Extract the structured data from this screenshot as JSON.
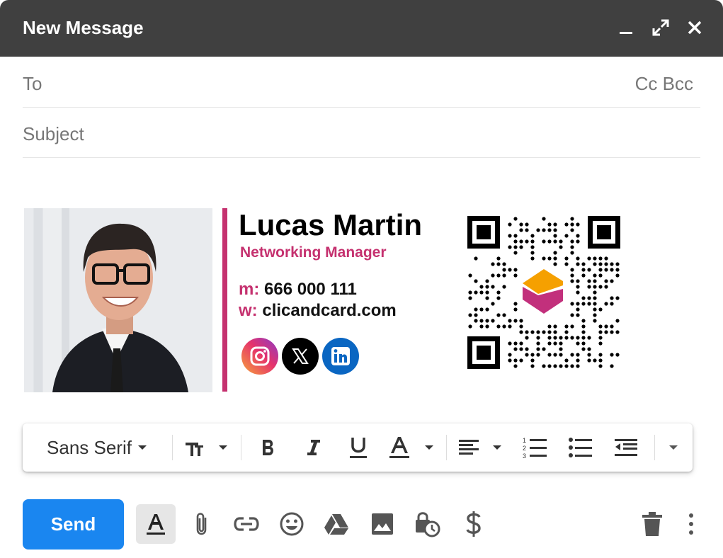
{
  "window": {
    "title": "New Message",
    "controls": [
      "minimize-icon",
      "expand-icon",
      "close-icon"
    ]
  },
  "fields": {
    "to_placeholder": "To",
    "cc_bcc": "Cc Bcc",
    "subject_placeholder": "Subject"
  },
  "signature": {
    "name": "Lucas Martin",
    "role": "Networking Manager",
    "phone_key": "m:",
    "phone": "666 000 111",
    "web_key": "w:",
    "web": "clicandcard.com",
    "socials": [
      "instagram-icon",
      "x-icon",
      "linkedin-icon"
    ],
    "colors": {
      "accent": "#c5316f",
      "name": "#000000"
    }
  },
  "formatting_toolbar": {
    "font_family": "Sans Serif",
    "buttons": [
      "text-size-icon",
      "bold-icon",
      "italic-icon",
      "underline-icon",
      "text-color-icon",
      "align-icon",
      "numbered-list-icon",
      "bulleted-list-icon",
      "indent-less-icon",
      "more-formatting-icon"
    ]
  },
  "bottom_bar": {
    "send_label": "Send",
    "actions": [
      "formatting-options-icon",
      "attach-icon",
      "link-icon",
      "emoji-icon",
      "drive-icon",
      "photo-icon",
      "confidential-mode-icon",
      "dollar-icon",
      "trash-icon",
      "more-options-icon"
    ],
    "colors": {
      "send": "#1a86f0",
      "header": "#404040"
    }
  }
}
